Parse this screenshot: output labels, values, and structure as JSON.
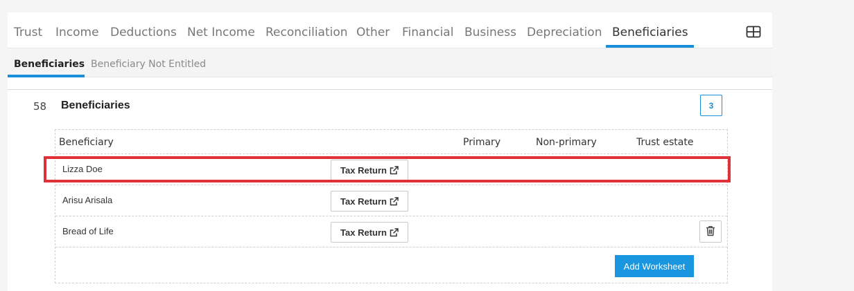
{
  "main_tabs": [
    {
      "label": "Trust"
    },
    {
      "label": "Income"
    },
    {
      "label": "Deductions"
    },
    {
      "label": "Net Income"
    },
    {
      "label": "Reconciliation"
    },
    {
      "label": "Other"
    },
    {
      "label": "Financial"
    },
    {
      "label": "Business"
    },
    {
      "label": "Depreciation"
    },
    {
      "label": "Beneficiaries",
      "active": true
    }
  ],
  "sub_tabs": [
    {
      "label": "Beneficiaries",
      "active": true
    },
    {
      "label": "Beneficiary Not Entitled"
    }
  ],
  "section": {
    "number": "58",
    "title": "Beneficiaries",
    "count": "3"
  },
  "table": {
    "columns": [
      "Beneficiary",
      "Primary",
      "Non-primary",
      "Trust estate"
    ],
    "rows": [
      {
        "name": "Lizza Doe",
        "button": "Tax Return",
        "highlighted": true
      },
      {
        "name": "Arisu Arisala",
        "button": "Tax Return"
      },
      {
        "name": "Bread of Life",
        "button": "Tax Return",
        "has_delete": true
      }
    ]
  },
  "add_worksheet_label": "Add Worksheet",
  "colors": {
    "accent": "#1a8fd9",
    "highlight": "#e03039",
    "button_primary": "#1a96e0"
  },
  "icons": {
    "layout": "grid-layout-icon",
    "external": "external-link-icon",
    "delete": "trash-icon"
  }
}
